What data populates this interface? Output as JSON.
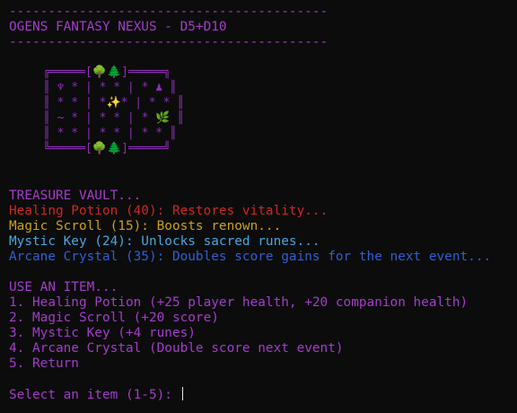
{
  "header": {
    "rule_top": "-----------------------------------------",
    "title": "OGENS FANTASY NEXUS - D5+D10",
    "rule_bottom": "-----------------------------------------"
  },
  "map": {
    "rows": [
      "╔═════[🌳🌲]═════╗",
      "║ ♆ * | * * | * ♟ ║",
      "║ * * | *✨* | * * ║",
      "║ ~ * | * * | * 🌿 ║",
      "║ * * | * * | * * ║",
      "╚═════[🌳🌲]═════╝"
    ]
  },
  "vault": {
    "heading": "TREASURE VAULT...",
    "items": [
      {
        "text": "Healing Potion (40): Restores vitality...",
        "color": "#d02626"
      },
      {
        "text": "Magic Scroll (15): Boosts renown...",
        "color": "#c9a11a"
      },
      {
        "text": "Mystic Key (24): Unlocks sacred runes...",
        "color": "#4aa6e0"
      },
      {
        "text": "Arcane Crystal (35): Doubles score gains for the next event...",
        "color": "#2f5fd6"
      }
    ]
  },
  "menu": {
    "heading": "USE AN ITEM...",
    "options": [
      "1. Healing Potion (+25 player health, +20 companion health)",
      "2. Magic Scroll (+20 score)",
      "3. Mystic Key (+4 runes)",
      "4. Arcane Crystal (Double score next event)",
      "5. Return"
    ]
  },
  "prompt": {
    "text": "Select an item (1-5): ",
    "value": ""
  }
}
